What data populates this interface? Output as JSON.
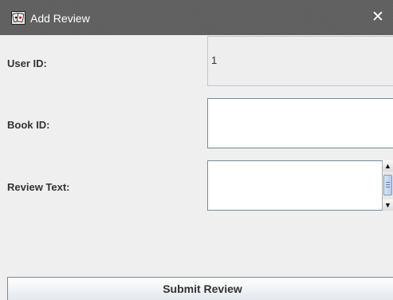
{
  "window": {
    "title": "Add Review",
    "close_symbol": "✕",
    "icon": "app-cards-icon"
  },
  "form": {
    "user_id": {
      "label": "User ID:",
      "value": "1"
    },
    "book_id": {
      "label": "Book ID:",
      "value": "",
      "placeholder": ""
    },
    "review_text": {
      "label": "Review Text:",
      "value": ""
    },
    "submit_label": "Submit Review"
  },
  "colors": {
    "titlebar": "#5f5f5f",
    "window_bg": "#efefef",
    "field_border": "#7a8a99",
    "readonly_border": "#b9c8dc"
  }
}
